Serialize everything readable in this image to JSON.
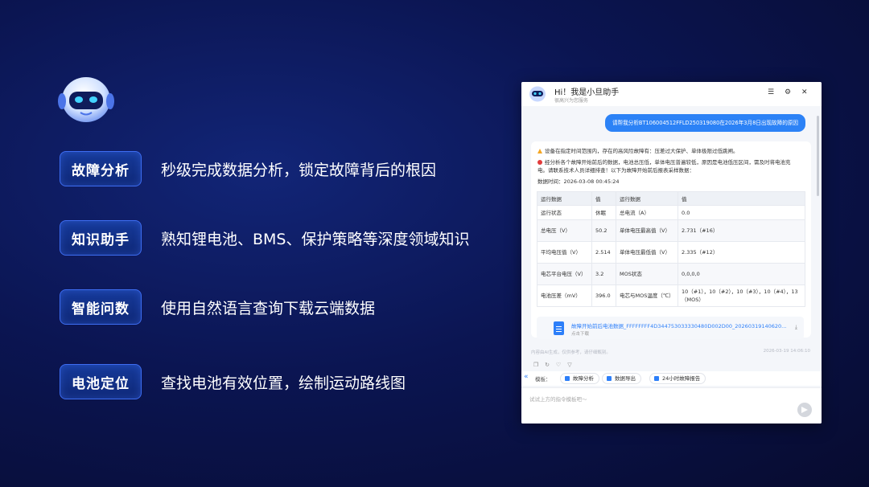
{
  "features": [
    {
      "tag": "故障分析",
      "desc": "秒级完成数据分析，锁定故障背后的根因"
    },
    {
      "tag": "知识助手",
      "desc": "熟知锂电池、BMS、保护策略等深度领域知识"
    },
    {
      "tag": "智能问数",
      "desc": "使用自然语言查询下载云端数据"
    },
    {
      "tag": "电池定位",
      "desc": "查找电池有效位置，绘制运动路线图"
    }
  ],
  "chat": {
    "title": "Hi！我是小旦助手",
    "subtitle": "很高兴为您服务",
    "user_message": "请帮我分析BT106004512FFLD250319080在2026年3月8日出现故障的原因",
    "reply": {
      "warning": "设备在指定时间范围内，存在的高风险故障有：压差过大保护、单体极限过低跳闸。",
      "analysis_1": "经分析各个故障开始前后的数据，电池总压低，单体电压普遍较低，原因是电池低压区间，需及时将电池充",
      "analysis_2": "电。请联系技术人员详细排查！以下为故障开始前后报表采样数据：",
      "data_time": "数据时间：2026-03-08 00:45:24",
      "table": {
        "headers": [
          "运行数据",
          "值",
          "运行数据",
          "值"
        ],
        "rows": [
          [
            "运行状态",
            "休眠",
            "总电流（A）",
            "0.0"
          ],
          [
            "总电压（V）",
            "50.2",
            "单体电压最高值（V）",
            "2.731（#16）"
          ],
          [
            "平均电压值（V）",
            "2.514",
            "单体电压最低值（V）",
            "2.335（#12）"
          ],
          [
            "电芯平台电压（V）",
            "3.2",
            "MOS状态",
            "0,0,0,0"
          ],
          [
            "电池压差（mV）",
            "396.0",
            "电芯与MOS温度（℃）",
            "10（#1），10（#2），10（#3），10（#4），13（MOS）"
          ]
        ]
      },
      "file_name": "故障开始前后电池数据_FFFFFFFF4D344753033330480D002D00_20260319140620...",
      "file_sub": "点击下载"
    },
    "ai_note": "内容由AI生成，仅供参考，请仔细甄别。",
    "timestamp": "2026-03-19 14:06:10",
    "template_label": "模板：",
    "templates": [
      "故障分析",
      "数据导出",
      "24小时故障报告"
    ],
    "input_placeholder": "试试上方的指令模板吧～"
  },
  "colors": {
    "accent": "#2c82f6",
    "pill_border": "#3d6df2",
    "bg": "#0b1552"
  }
}
